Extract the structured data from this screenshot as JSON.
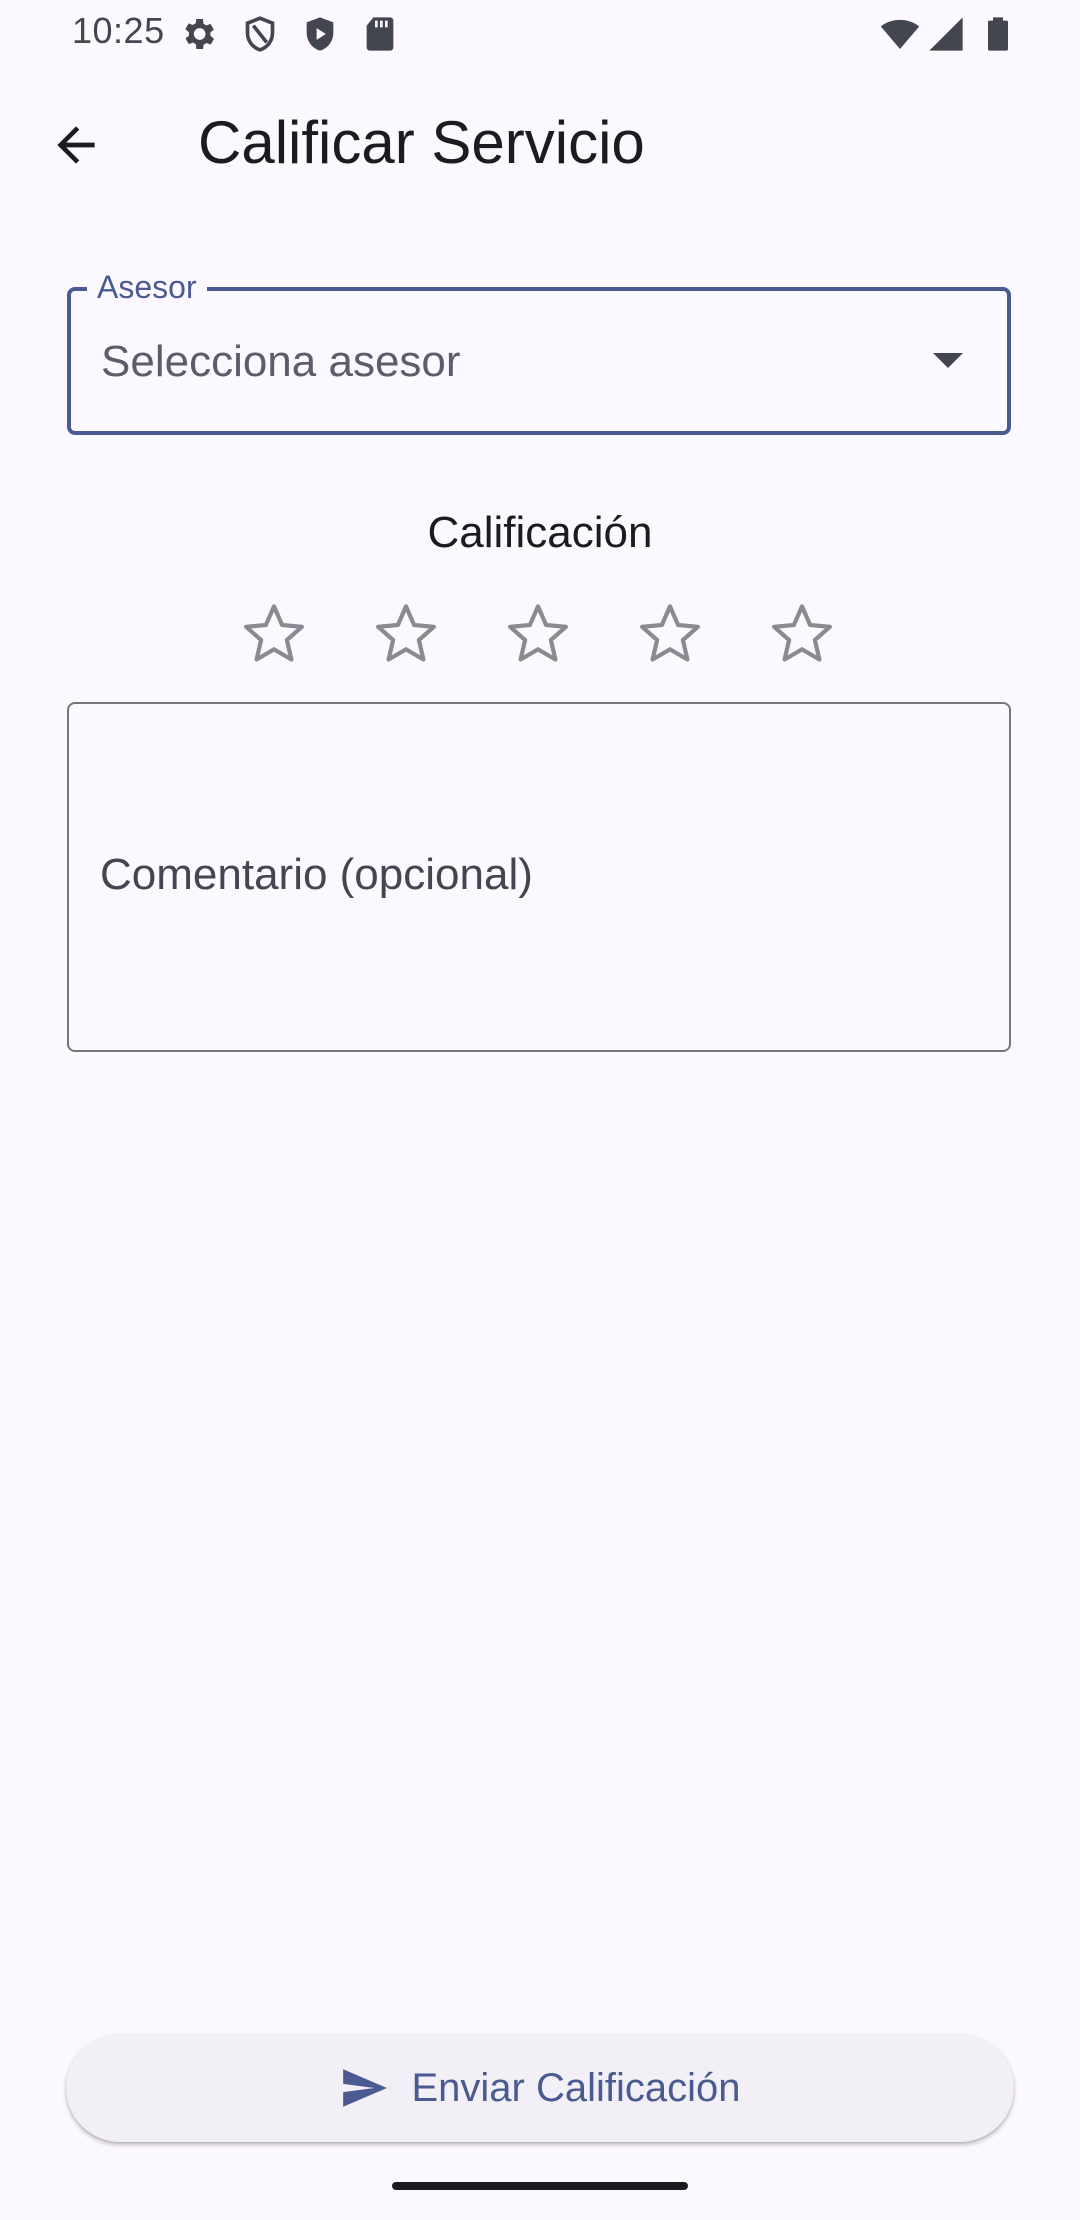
{
  "status_bar": {
    "time": "10:25",
    "left_icons": [
      "gear-icon",
      "shield-outline-icon",
      "shield-play-icon",
      "sd-card-icon"
    ],
    "right_icons": [
      "wifi-icon",
      "cell-signal-icon",
      "battery-icon"
    ]
  },
  "app_bar": {
    "back_icon": "arrow-back-icon",
    "title": "Calificar Servicio"
  },
  "advisor_dropdown": {
    "label": "Asesor",
    "value": "Selecciona asesor",
    "arrow_icon": "dropdown-arrow-icon"
  },
  "rating": {
    "label": "Calificación",
    "max_stars": 5,
    "selected_stars": 0
  },
  "comment": {
    "placeholder": "Comentario (opcional)"
  },
  "submit": {
    "icon": "send-icon",
    "label": "Enviar Calificación"
  },
  "colors": {
    "primary": "#4a5b91",
    "background": "#fcf8ff",
    "button_surface": "#f3eff7",
    "star_outline": "#8a8b92"
  }
}
